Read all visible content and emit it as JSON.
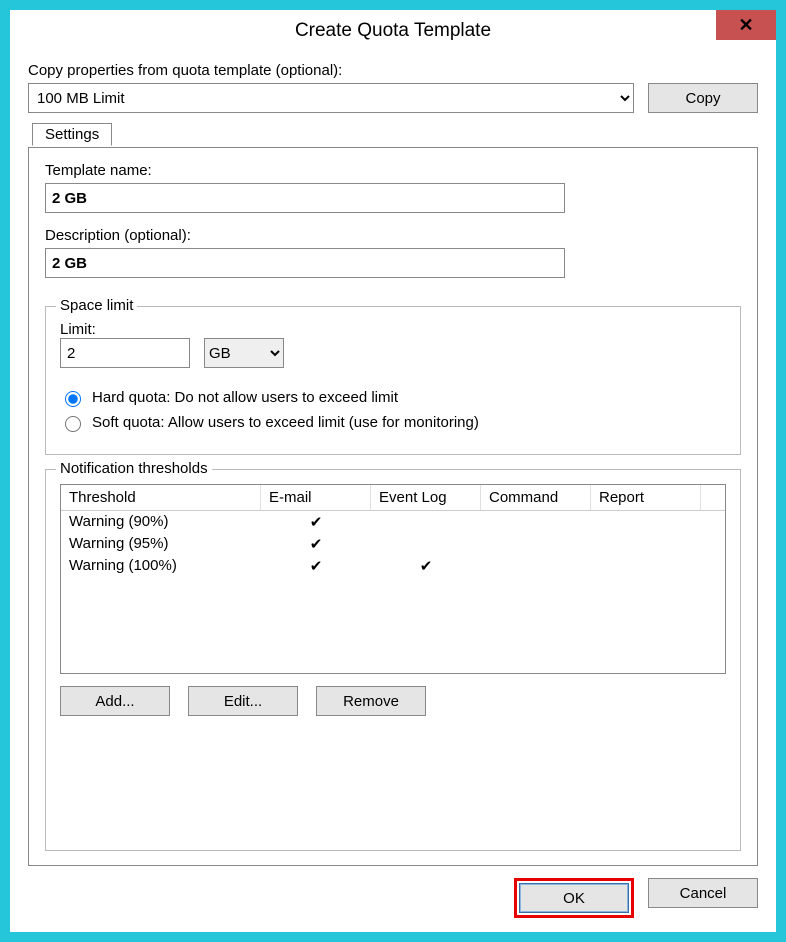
{
  "window": {
    "title": "Create Quota Template"
  },
  "copy_section": {
    "label": "Copy properties from quota template (optional):",
    "selected": "100 MB Limit",
    "copy_btn": "Copy"
  },
  "tab": {
    "label": "Settings"
  },
  "template_name": {
    "label": "Template name:",
    "value": "2 GB"
  },
  "description": {
    "label": "Description (optional):",
    "value": "2 GB"
  },
  "space_limit": {
    "legend": "Space limit",
    "limit_label": "Limit:",
    "limit_value": "2",
    "unit": "GB",
    "hard_label": "Hard quota: Do not allow users to exceed limit",
    "soft_label": "Soft quota: Allow users to exceed limit (use for monitoring)",
    "selected": "hard"
  },
  "thresholds": {
    "legend": "Notification thresholds",
    "headers": {
      "threshold": "Threshold",
      "email": "E-mail",
      "event": "Event Log",
      "command": "Command",
      "report": "Report"
    },
    "rows": [
      {
        "label": "Warning (90%)",
        "email": true,
        "event": false,
        "command": false,
        "report": false
      },
      {
        "label": "Warning (95%)",
        "email": true,
        "event": false,
        "command": false,
        "report": false
      },
      {
        "label": "Warning (100%)",
        "email": true,
        "event": true,
        "command": false,
        "report": false
      }
    ],
    "buttons": {
      "add": "Add...",
      "edit": "Edit...",
      "remove": "Remove"
    }
  },
  "dialog_buttons": {
    "ok": "OK",
    "cancel": "Cancel"
  },
  "icons": {
    "check": "✔"
  }
}
